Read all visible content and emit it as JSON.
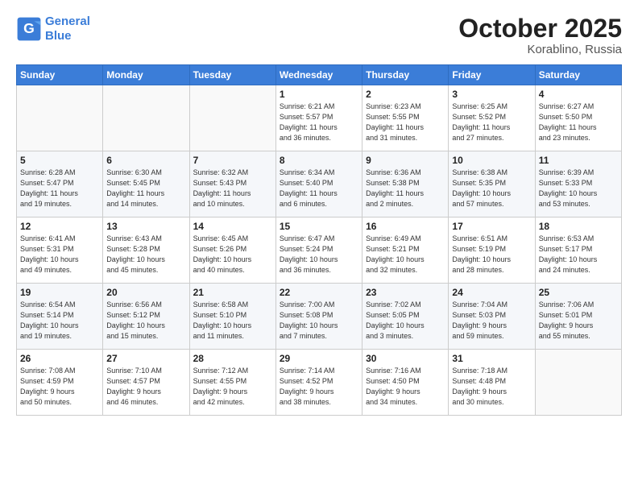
{
  "header": {
    "logo_line1": "General",
    "logo_line2": "Blue",
    "month": "October 2025",
    "location": "Korablino, Russia"
  },
  "weekdays": [
    "Sunday",
    "Monday",
    "Tuesday",
    "Wednesday",
    "Thursday",
    "Friday",
    "Saturday"
  ],
  "weeks": [
    [
      {
        "day": "",
        "info": ""
      },
      {
        "day": "",
        "info": ""
      },
      {
        "day": "",
        "info": ""
      },
      {
        "day": "1",
        "info": "Sunrise: 6:21 AM\nSunset: 5:57 PM\nDaylight: 11 hours\nand 36 minutes."
      },
      {
        "day": "2",
        "info": "Sunrise: 6:23 AM\nSunset: 5:55 PM\nDaylight: 11 hours\nand 31 minutes."
      },
      {
        "day": "3",
        "info": "Sunrise: 6:25 AM\nSunset: 5:52 PM\nDaylight: 11 hours\nand 27 minutes."
      },
      {
        "day": "4",
        "info": "Sunrise: 6:27 AM\nSunset: 5:50 PM\nDaylight: 11 hours\nand 23 minutes."
      }
    ],
    [
      {
        "day": "5",
        "info": "Sunrise: 6:28 AM\nSunset: 5:47 PM\nDaylight: 11 hours\nand 19 minutes."
      },
      {
        "day": "6",
        "info": "Sunrise: 6:30 AM\nSunset: 5:45 PM\nDaylight: 11 hours\nand 14 minutes."
      },
      {
        "day": "7",
        "info": "Sunrise: 6:32 AM\nSunset: 5:43 PM\nDaylight: 11 hours\nand 10 minutes."
      },
      {
        "day": "8",
        "info": "Sunrise: 6:34 AM\nSunset: 5:40 PM\nDaylight: 11 hours\nand 6 minutes."
      },
      {
        "day": "9",
        "info": "Sunrise: 6:36 AM\nSunset: 5:38 PM\nDaylight: 11 hours\nand 2 minutes."
      },
      {
        "day": "10",
        "info": "Sunrise: 6:38 AM\nSunset: 5:35 PM\nDaylight: 10 hours\nand 57 minutes."
      },
      {
        "day": "11",
        "info": "Sunrise: 6:39 AM\nSunset: 5:33 PM\nDaylight: 10 hours\nand 53 minutes."
      }
    ],
    [
      {
        "day": "12",
        "info": "Sunrise: 6:41 AM\nSunset: 5:31 PM\nDaylight: 10 hours\nand 49 minutes."
      },
      {
        "day": "13",
        "info": "Sunrise: 6:43 AM\nSunset: 5:28 PM\nDaylight: 10 hours\nand 45 minutes."
      },
      {
        "day": "14",
        "info": "Sunrise: 6:45 AM\nSunset: 5:26 PM\nDaylight: 10 hours\nand 40 minutes."
      },
      {
        "day": "15",
        "info": "Sunrise: 6:47 AM\nSunset: 5:24 PM\nDaylight: 10 hours\nand 36 minutes."
      },
      {
        "day": "16",
        "info": "Sunrise: 6:49 AM\nSunset: 5:21 PM\nDaylight: 10 hours\nand 32 minutes."
      },
      {
        "day": "17",
        "info": "Sunrise: 6:51 AM\nSunset: 5:19 PM\nDaylight: 10 hours\nand 28 minutes."
      },
      {
        "day": "18",
        "info": "Sunrise: 6:53 AM\nSunset: 5:17 PM\nDaylight: 10 hours\nand 24 minutes."
      }
    ],
    [
      {
        "day": "19",
        "info": "Sunrise: 6:54 AM\nSunset: 5:14 PM\nDaylight: 10 hours\nand 19 minutes."
      },
      {
        "day": "20",
        "info": "Sunrise: 6:56 AM\nSunset: 5:12 PM\nDaylight: 10 hours\nand 15 minutes."
      },
      {
        "day": "21",
        "info": "Sunrise: 6:58 AM\nSunset: 5:10 PM\nDaylight: 10 hours\nand 11 minutes."
      },
      {
        "day": "22",
        "info": "Sunrise: 7:00 AM\nSunset: 5:08 PM\nDaylight: 10 hours\nand 7 minutes."
      },
      {
        "day": "23",
        "info": "Sunrise: 7:02 AM\nSunset: 5:05 PM\nDaylight: 10 hours\nand 3 minutes."
      },
      {
        "day": "24",
        "info": "Sunrise: 7:04 AM\nSunset: 5:03 PM\nDaylight: 9 hours\nand 59 minutes."
      },
      {
        "day": "25",
        "info": "Sunrise: 7:06 AM\nSunset: 5:01 PM\nDaylight: 9 hours\nand 55 minutes."
      }
    ],
    [
      {
        "day": "26",
        "info": "Sunrise: 7:08 AM\nSunset: 4:59 PM\nDaylight: 9 hours\nand 50 minutes."
      },
      {
        "day": "27",
        "info": "Sunrise: 7:10 AM\nSunset: 4:57 PM\nDaylight: 9 hours\nand 46 minutes."
      },
      {
        "day": "28",
        "info": "Sunrise: 7:12 AM\nSunset: 4:55 PM\nDaylight: 9 hours\nand 42 minutes."
      },
      {
        "day": "29",
        "info": "Sunrise: 7:14 AM\nSunset: 4:52 PM\nDaylight: 9 hours\nand 38 minutes."
      },
      {
        "day": "30",
        "info": "Sunrise: 7:16 AM\nSunset: 4:50 PM\nDaylight: 9 hours\nand 34 minutes."
      },
      {
        "day": "31",
        "info": "Sunrise: 7:18 AM\nSunset: 4:48 PM\nDaylight: 9 hours\nand 30 minutes."
      },
      {
        "day": "",
        "info": ""
      }
    ]
  ]
}
